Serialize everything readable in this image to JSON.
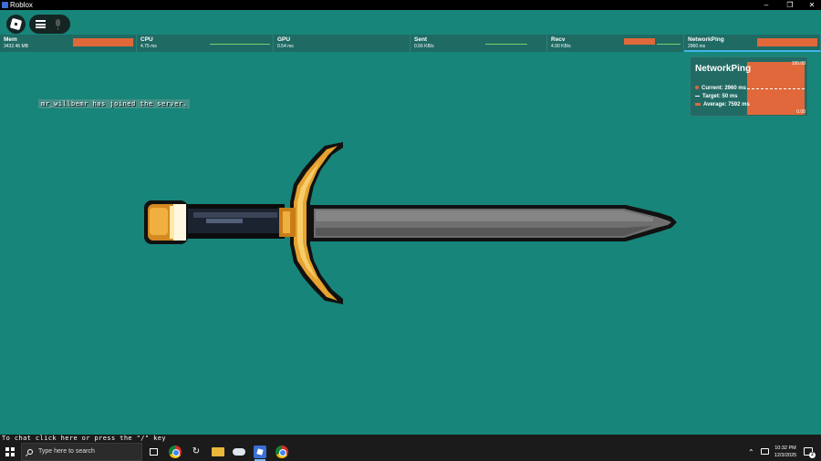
{
  "window": {
    "title": "Roblox",
    "controls": [
      "–",
      "❐",
      "✕"
    ]
  },
  "stats": [
    {
      "label": "Mem",
      "value": "3432.46 MB"
    },
    {
      "label": "CPU",
      "value": "4.75 ms"
    },
    {
      "label": "GPU",
      "value": "0.54 ms"
    },
    {
      "label": "Sent",
      "value": "0.56 KB/s"
    },
    {
      "label": "Recv",
      "value": "4.90 KB/s"
    },
    {
      "label": "NetworkPing",
      "value": "2960 ms"
    }
  ],
  "ping_panel": {
    "title": "NetworkPing",
    "y_max": "100.00",
    "y_min": "0.00",
    "current": "Current: 2960 ms",
    "target": "Target: 50 ms",
    "average": "Average: 7592 ms"
  },
  "chat": {
    "join_message": "mr_willbemr has joined the server.",
    "hint": "To chat click here or press the \"/\" key"
  },
  "taskbar": {
    "search_placeholder": "Type here to search",
    "time": "10:32 PM",
    "date": "12/3/2025",
    "notification_count": "2"
  },
  "colors": {
    "background": "#17857a",
    "stats_bar": "#1f6a63",
    "graph_fill": "#e0683a"
  }
}
